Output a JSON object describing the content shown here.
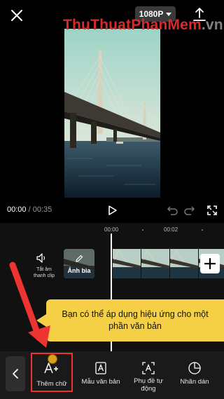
{
  "header": {
    "close_icon": "close-icon",
    "resolution_label": "1080P",
    "export_icon": "export-icon",
    "watermark": {
      "part1": "ThuThuat",
      "part2": "PhanMem",
      "part3": ".vn"
    }
  },
  "player": {
    "current_time": "00:00",
    "separator": " / ",
    "duration": "00:35",
    "play_icon": "play-icon",
    "undo_icon": "undo-icon",
    "redo_icon": "redo-icon",
    "fullscreen_icon": "fullscreen-icon"
  },
  "timeline": {
    "ruler": [
      "00:00",
      "00:02"
    ],
    "mute_label_line1": "Tắt âm",
    "mute_label_line2": "thanh clip",
    "cover_label": "Ảnh bìa"
  },
  "tooltip": {
    "text": "Bạn có thể áp dụng hiệu ứng cho một phần văn bản"
  },
  "toolbar": {
    "items": [
      {
        "label": "Thêm chữ",
        "icon": "add-text-icon"
      },
      {
        "label": "Mẫu văn bản",
        "icon": "text-template-icon"
      },
      {
        "label": "Phụ đề tự động",
        "icon": "auto-captions-icon"
      },
      {
        "label": "Nhãn dán",
        "icon": "sticker-icon"
      }
    ]
  },
  "colors": {
    "tooltip": "#f5cf45",
    "highlight": "#e33333",
    "watermark_red": "#d72a2a"
  }
}
